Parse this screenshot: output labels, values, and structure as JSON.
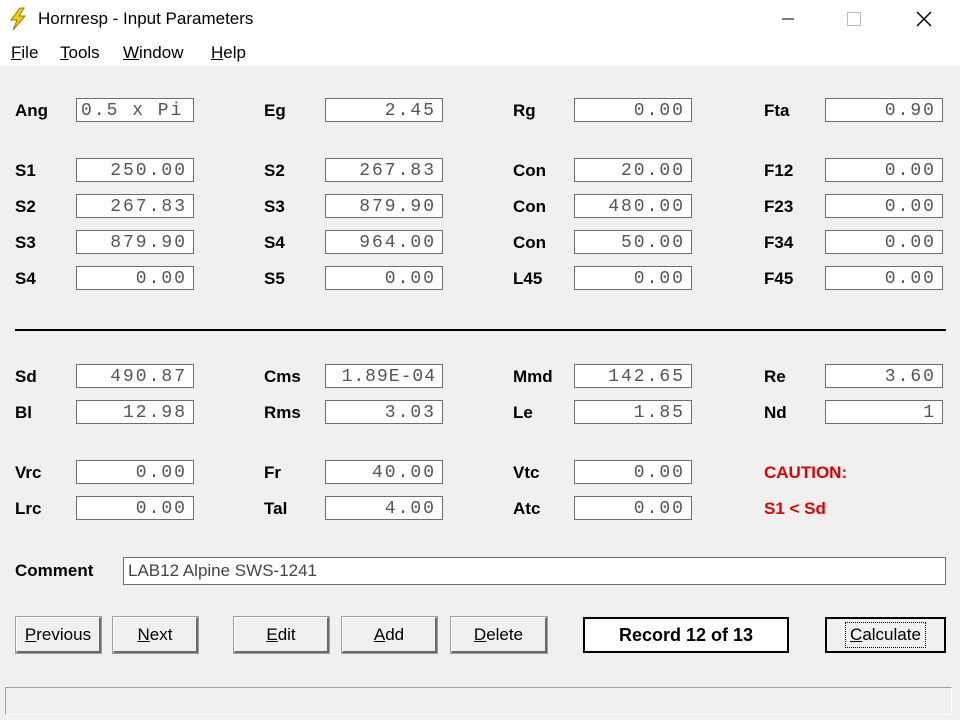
{
  "window": {
    "title": "Hornresp - Input Parameters"
  },
  "menu": [
    {
      "id": "file",
      "label": "File",
      "mn": "F",
      "rest": "ile"
    },
    {
      "id": "tools",
      "label": "Tools",
      "mn": "T",
      "rest": "ools"
    },
    {
      "id": "window",
      "label": "Window",
      "mn": "W",
      "rest": "indow"
    },
    {
      "id": "help",
      "label": "Help",
      "mn": "H",
      "rest": "elp"
    }
  ],
  "fields": {
    "ang": {
      "label": "Ang",
      "value": "0.5 x Pi"
    },
    "eg": {
      "label": "Eg",
      "value": "2.45"
    },
    "rg": {
      "label": "Rg",
      "value": "0.00"
    },
    "fta": {
      "label": "Fta",
      "value": "0.90"
    },
    "s1": {
      "label": "S1",
      "value": "250.00"
    },
    "s2a": {
      "label": "S2",
      "value": "267.83"
    },
    "con1": {
      "label": "Con",
      "value": "20.00"
    },
    "f12": {
      "label": "F12",
      "value": "0.00"
    },
    "s2b": {
      "label": "S2",
      "value": "267.83"
    },
    "s3a": {
      "label": "S3",
      "value": "879.90"
    },
    "con2": {
      "label": "Con",
      "value": "480.00"
    },
    "f23": {
      "label": "F23",
      "value": "0.00"
    },
    "s3b": {
      "label": "S3",
      "value": "879.90"
    },
    "s4a": {
      "label": "S4",
      "value": "964.00"
    },
    "con3": {
      "label": "Con",
      "value": "50.00"
    },
    "f34": {
      "label": "F34",
      "value": "0.00"
    },
    "s4b": {
      "label": "S4",
      "value": "0.00"
    },
    "s5": {
      "label": "S5",
      "value": "0.00"
    },
    "l45": {
      "label": "L45",
      "value": "0.00"
    },
    "f45": {
      "label": "F45",
      "value": "0.00"
    },
    "sd": {
      "label": "Sd",
      "value": "490.87"
    },
    "cms": {
      "label": "Cms",
      "value": "1.89E-04"
    },
    "mmd": {
      "label": "Mmd",
      "value": "142.65"
    },
    "re": {
      "label": "Re",
      "value": "3.60"
    },
    "bl": {
      "label": "Bl",
      "value": "12.98"
    },
    "rms": {
      "label": "Rms",
      "value": "3.03"
    },
    "le": {
      "label": "Le",
      "value": "1.85"
    },
    "nd": {
      "label": "Nd",
      "value": "1"
    },
    "vrc": {
      "label": "Vrc",
      "value": "0.00"
    },
    "fr": {
      "label": "Fr",
      "value": "40.00"
    },
    "vtc": {
      "label": "Vtc",
      "value": "0.00"
    },
    "lrc": {
      "label": "Lrc",
      "value": "0.00"
    },
    "tal": {
      "label": "Tal",
      "value": "4.00"
    },
    "atc": {
      "label": "Atc",
      "value": "0.00"
    }
  },
  "caution": {
    "title": "CAUTION:",
    "message": "S1 < Sd",
    "color": "#e00000"
  },
  "comment": {
    "label": "Comment",
    "value": "LAB12 Alpine SWS-1241"
  },
  "buttons": {
    "previous": {
      "label": "Previous",
      "mn": "P",
      "rest": "revious"
    },
    "next": {
      "label": "Next",
      "mn": "N",
      "rest": "ext"
    },
    "edit": {
      "label": "Edit",
      "mn": "E",
      "rest": "dit"
    },
    "add": {
      "label": "Add",
      "mn": "A",
      "rest": "dd"
    },
    "delete": {
      "label": "Delete",
      "mn": "D",
      "rest": "elete"
    },
    "calculate": {
      "label": "Calculate",
      "mn": "C",
      "rest": "alculate"
    }
  },
  "record": {
    "text": "Record 12 of 13"
  },
  "icons": {
    "app": "lightning-bolt-icon"
  }
}
